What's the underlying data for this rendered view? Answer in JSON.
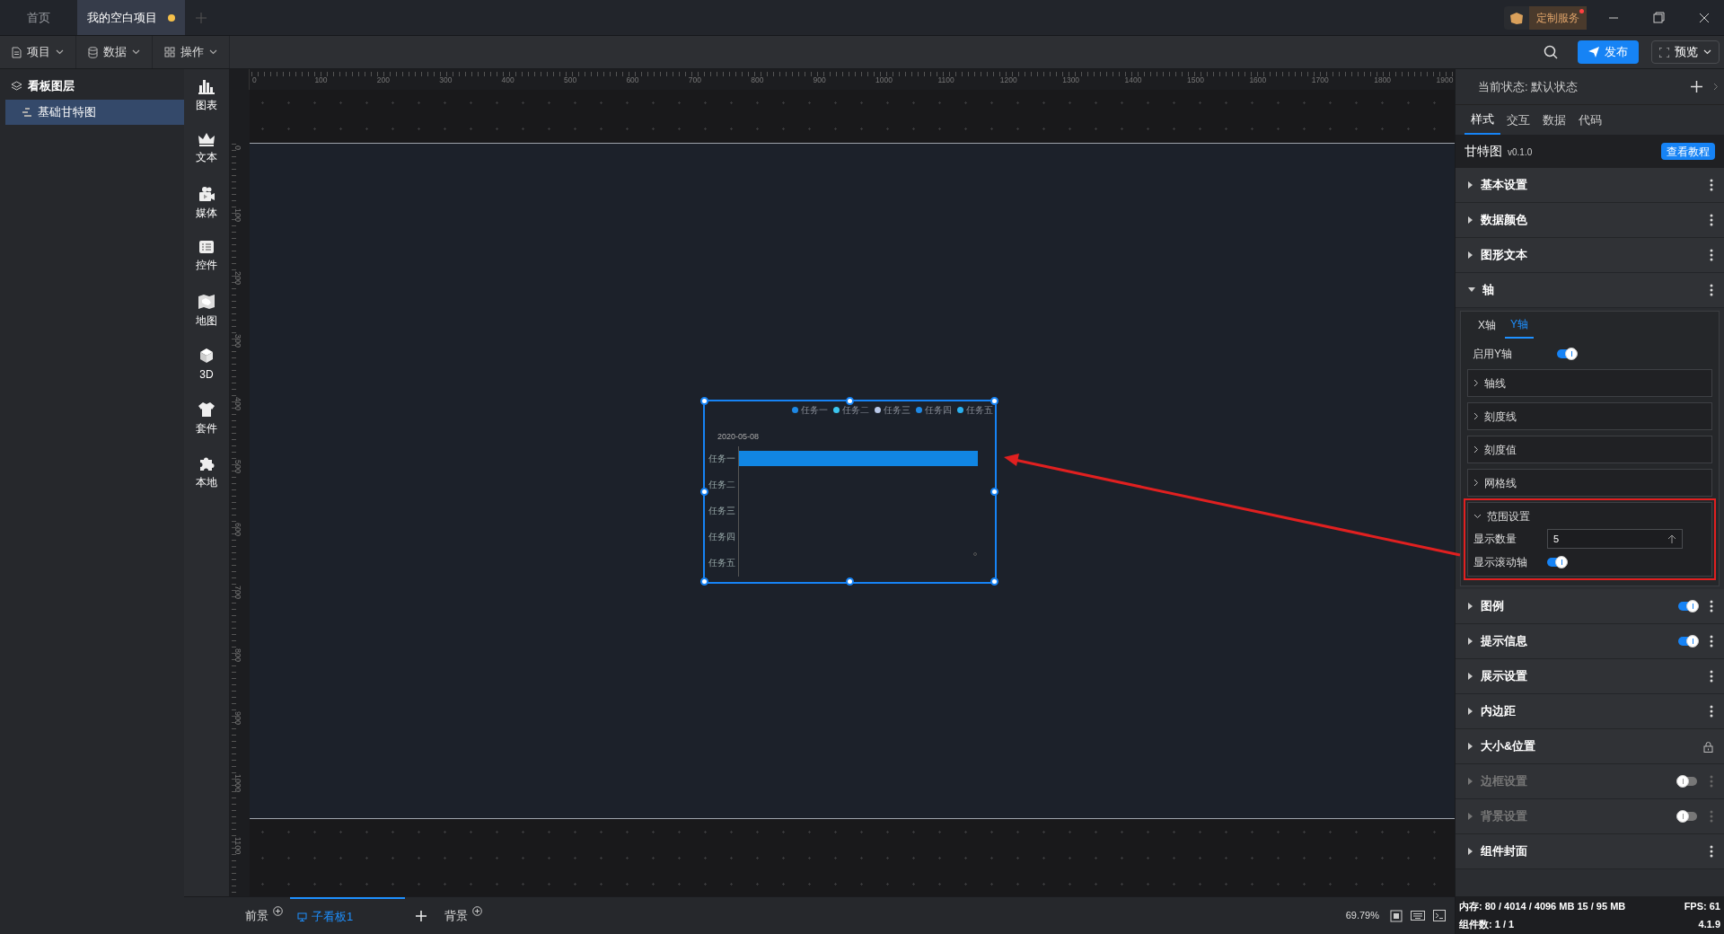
{
  "title_bar": {
    "tabs": [
      {
        "label": "首页",
        "selected": false,
        "modified": false
      },
      {
        "label": "我的空白项目",
        "selected": true,
        "modified": true
      }
    ],
    "service_button": "定制服务"
  },
  "toolbar": {
    "menus": [
      {
        "label": "项目",
        "kind": "file"
      },
      {
        "label": "数据",
        "kind": "database"
      },
      {
        "label": "操作",
        "kind": "grid"
      }
    ],
    "publish": "发布",
    "preview": "预览"
  },
  "layers": {
    "title": "看板图层",
    "items": [
      {
        "label": "基础甘特图",
        "selected": true
      }
    ]
  },
  "tools": [
    {
      "label": "图表",
      "kind": "chart"
    },
    {
      "label": "文本",
      "kind": "text"
    },
    {
      "label": "媒体",
      "kind": "media"
    },
    {
      "label": "控件",
      "kind": "control"
    },
    {
      "label": "地图",
      "kind": "map"
    },
    {
      "label": "3D",
      "kind": "cube"
    },
    {
      "label": "套件",
      "kind": "kit"
    },
    {
      "label": "本地",
      "kind": "local"
    }
  ],
  "ruler": {
    "x_labels": [
      "0",
      "100",
      "200",
      "300",
      "400",
      "500",
      "600",
      "700",
      "800",
      "900",
      "1000",
      "1100",
      "1200",
      "1300",
      "1400",
      "1500",
      "1600",
      "1700",
      "1800",
      "1900"
    ],
    "y_labels": [
      "0",
      "100",
      "200",
      "300",
      "400",
      "500",
      "600",
      "700",
      "800",
      "900",
      "1000",
      "1100"
    ]
  },
  "gantt": {
    "legend": [
      {
        "label": "任务一",
        "color": "#1e88e5"
      },
      {
        "label": "任务二",
        "color": "#3cc6ef"
      },
      {
        "label": "任务三",
        "color": "#b9c8e8"
      },
      {
        "label": "任务四",
        "color": "#1e88e5"
      },
      {
        "label": "任务五",
        "color": "#2ab0f0"
      }
    ],
    "date": "2020-05-08",
    "rows": [
      {
        "label": "任务一",
        "has_bar": true
      },
      {
        "label": "任务二",
        "has_bar": false
      },
      {
        "label": "任务三",
        "has_bar": false
      },
      {
        "label": "任务四",
        "has_bar": false
      },
      {
        "label": "任务五",
        "has_bar": false
      }
    ]
  },
  "bottom_tabs": [
    {
      "label": "前景",
      "kind": "layer",
      "selected": false
    },
    {
      "label": "子看板1",
      "kind": "board",
      "selected": true
    },
    {
      "label": "背景",
      "kind": "layer",
      "selected": false
    }
  ],
  "zoom": "69.79%",
  "right_panel": {
    "state_label": "当前状态:",
    "state_value": "默认状态",
    "tabs": [
      {
        "label": "样式",
        "selected": true
      },
      {
        "label": "交互",
        "selected": false
      },
      {
        "label": "数据",
        "selected": false
      },
      {
        "label": "代码",
        "selected": false
      }
    ],
    "component": {
      "name": "甘特图",
      "version": "v0.1.0",
      "tutorial": "查看教程"
    },
    "sections": [
      {
        "label": "基本设置",
        "kind": "menu",
        "expanded": false,
        "disabled": false
      },
      {
        "label": "数据颜色",
        "kind": "menu",
        "expanded": false,
        "disabled": false
      },
      {
        "label": "图形文本",
        "kind": "menu",
        "expanded": false,
        "disabled": false
      },
      {
        "label": "轴",
        "kind": "menu",
        "expanded": true,
        "disabled": false,
        "panel": {
          "tabs": [
            {
              "label": "X轴",
              "selected": false
            },
            {
              "label": "Y轴",
              "selected": true
            }
          ],
          "enable": {
            "label": "启用Y轴",
            "on": true
          },
          "groups": [
            {
              "label": "轴线",
              "expanded": false
            },
            {
              "label": "刻度线",
              "expanded": false
            },
            {
              "label": "刻度值",
              "expanded": false
            },
            {
              "label": "网格线",
              "expanded": false
            },
            {
              "label": "范围设置",
              "expanded": true,
              "fields": [
                {
                  "kind": "number",
                  "label": "显示数量",
                  "value": "5"
                },
                {
                  "kind": "switch",
                  "label": "显示滚动轴",
                  "on": true
                }
              ]
            }
          ]
        }
      },
      {
        "label": "图例",
        "kind": "menu",
        "expanded": false,
        "disabled": false,
        "toggle": true
      },
      {
        "label": "提示信息",
        "kind": "menu",
        "expanded": false,
        "disabled": false,
        "toggle": true
      },
      {
        "label": "展示设置",
        "kind": "menu",
        "expanded": false,
        "disabled": false
      },
      {
        "label": "内边距",
        "kind": "menu",
        "expanded": false,
        "disabled": false
      },
      {
        "label": "大小&位置",
        "kind": "lock",
        "expanded": false,
        "disabled": false
      },
      {
        "label": "边框设置",
        "kind": "menu",
        "expanded": false,
        "disabled": true,
        "toggle": false
      },
      {
        "label": "背景设置",
        "kind": "menu",
        "expanded": false,
        "disabled": true,
        "toggle": false
      },
      {
        "label": "组件封面",
        "kind": "menu",
        "expanded": false,
        "disabled": false
      }
    ],
    "status": {
      "memory": "内存:  80 / 4014 / 4096 MB  15 / 95 MB",
      "fps": "FPS:  61",
      "count": "组件数: 1 / 1",
      "version": "4.1.9"
    }
  }
}
